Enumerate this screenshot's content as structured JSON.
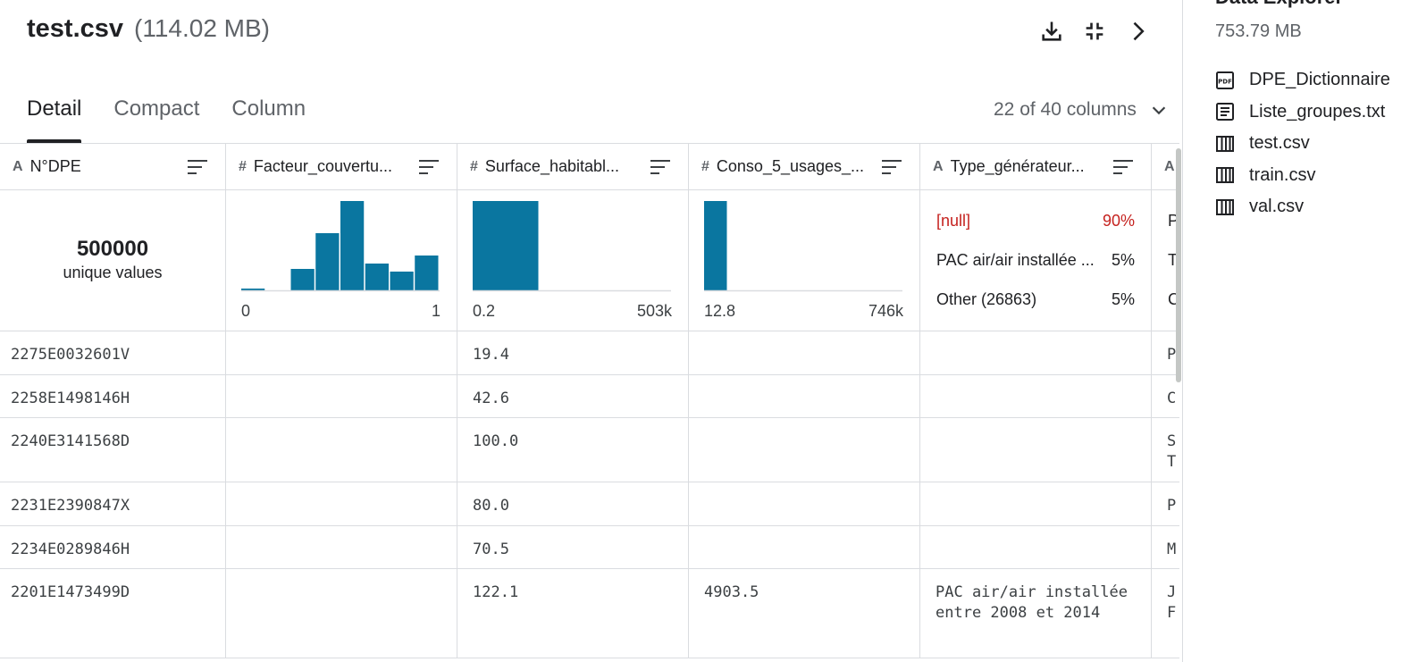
{
  "header": {
    "file_name": "test.csv",
    "file_size": "(114.02 MB)"
  },
  "header_icons": [
    "download-icon",
    "collapse-icon",
    "chevron-right-icon"
  ],
  "tabs": [
    {
      "label": "Detail",
      "active": true
    },
    {
      "label": "Compact",
      "active": false
    },
    {
      "label": "Column",
      "active": false
    }
  ],
  "column_selector": "22 of 40 columns",
  "columns": [
    {
      "type_icon": "A",
      "label": "N°DPE"
    },
    {
      "type_icon": "#",
      "label": "Facteur_couvertu..."
    },
    {
      "type_icon": "#",
      "label": "Surface_habitabl..."
    },
    {
      "type_icon": "#",
      "label": "Conso_5_usages_..."
    },
    {
      "type_icon": "A",
      "label": "Type_générateur..."
    },
    {
      "type_icon": "A",
      "label": ""
    }
  ],
  "summary": {
    "unique": {
      "value": "500000",
      "label": "unique values"
    },
    "hist1": {
      "min": "0",
      "max": "1",
      "bins": [
        0.02,
        0,
        0.24,
        0.64,
        1.0,
        0.3,
        0.21,
        0.39
      ]
    },
    "hist2": {
      "min": "0.2",
      "max": "503k",
      "bins": [
        1.0
      ]
    },
    "hist3": {
      "min": "12.8",
      "max": "746k",
      "bins": [
        1.0
      ]
    },
    "categories": [
      {
        "label": "[null]",
        "pct": "90%",
        "null": true
      },
      {
        "label": "PAC air/air installée ...",
        "pct": "5%",
        "null": false
      },
      {
        "label": "Other (26863)",
        "pct": "5%",
        "null": false
      }
    ],
    "col6_clipped": [
      "P",
      "T",
      "C"
    ]
  },
  "rows": [
    {
      "c0": "2275E0032601V",
      "c1": "",
      "c2": "19.4",
      "c3": "",
      "c4": "",
      "c5": "P"
    },
    {
      "c0": "2258E1498146H",
      "c1": "",
      "c2": "42.6",
      "c3": "",
      "c4": "",
      "c5": "C"
    },
    {
      "c0": "2240E3141568D",
      "c1": "",
      "c2": "100.0",
      "c3": "",
      "c4": "",
      "c5": "S\nT"
    },
    {
      "c0": "2231E2390847X",
      "c1": "",
      "c2": "80.0",
      "c3": "",
      "c4": "",
      "c5": "P"
    },
    {
      "c0": "2234E0289846H",
      "c1": "",
      "c2": "70.5",
      "c3": "",
      "c4": "",
      "c5": "M"
    },
    {
      "c0": "2201E1473499D",
      "c1": "",
      "c2": "122.1",
      "c3": "4903.5",
      "c4": "PAC air/air installée entre 2008 et 2014",
      "c5": "J\nF"
    }
  ],
  "sidebar": {
    "title": "Data Explorer",
    "size": "753.79 MB",
    "files": [
      {
        "name": "DPE_Dictionnaire",
        "icon": "pdf-icon",
        "selected": false
      },
      {
        "name": "Liste_groupes.txt",
        "icon": "text-file-icon",
        "selected": false
      },
      {
        "name": "test.csv",
        "icon": "table-icon",
        "selected": true
      },
      {
        "name": "train.csv",
        "icon": "table-icon",
        "selected": false
      },
      {
        "name": "val.csv",
        "icon": "table-icon",
        "selected": false
      }
    ]
  },
  "colors": {
    "bar": "#0a76a0",
    "null": "#c5221f",
    "border": "#dadce0"
  }
}
